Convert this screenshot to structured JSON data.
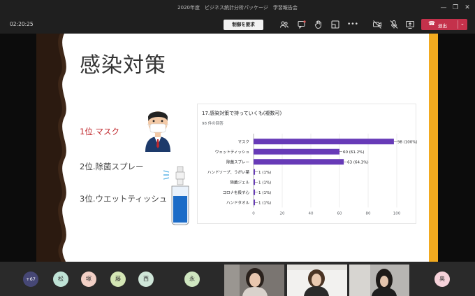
{
  "app": {
    "window_title": "2020年度　ビジネス統計分析パッケージ　学習報告会"
  },
  "toolbar": {
    "timer": "02:20:25",
    "request_control_label": "制御を要求",
    "leave_label": "退出",
    "leave_color": "#c4314b"
  },
  "slide": {
    "title": "感染対策",
    "ranks": [
      "1位.マスク",
      "2位.除菌スプレー",
      "3位.ウエットティッシュ"
    ],
    "accent_color": "#f2aa1f",
    "first_rank_color": "#c0282d"
  },
  "survey": {
    "title": "17.感染対策で持っていくも(複数可)",
    "responses": "98 件の回答"
  },
  "chart_data": {
    "type": "bar",
    "orientation": "horizontal",
    "categories": [
      "マスク",
      "ウェットティッシュ",
      "除菌スプレー",
      "ハンドソープ、うがい薬",
      "除菌ジェル",
      "コロナを殺す心",
      "ハンドタオル"
    ],
    "values": [
      98,
      60,
      63,
      1,
      1,
      1,
      1
    ],
    "data_labels": [
      "98 (100%)",
      "60 (61.2%)",
      "63 (64.3%)",
      "1 (1%)",
      "1 (1%)",
      "1 (1%)",
      "1 (1%)"
    ],
    "xlim": [
      0,
      100
    ],
    "xticks": [
      "0",
      "20",
      "40",
      "60",
      "80",
      "100"
    ],
    "color": "#673ab7",
    "grid": true
  },
  "participants": {
    "more_count": "+67",
    "avatars": [
      {
        "initial": "松",
        "color": "#bfe3d6"
      },
      {
        "initial": "塚",
        "color": "#f2d0c6"
      },
      {
        "initial": "藤",
        "color": "#d4e6b5"
      },
      {
        "initial": "西",
        "color": "#cfe6d8"
      },
      {
        "initial": "永",
        "color": "#cfe6c0"
      },
      {
        "initial": "奥",
        "color": "#f6d2da"
      }
    ]
  }
}
